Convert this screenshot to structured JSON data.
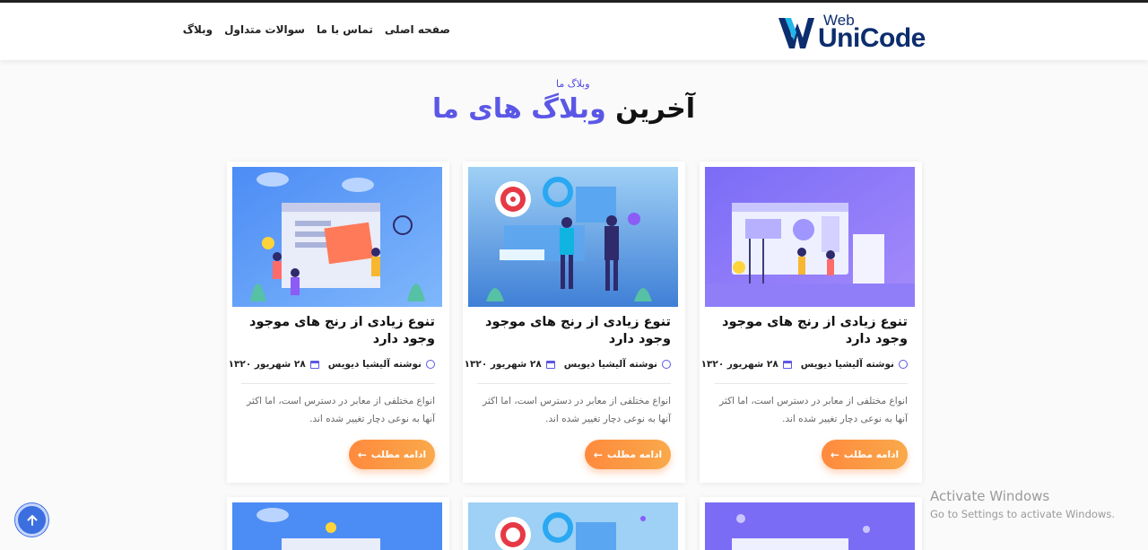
{
  "header": {
    "logo_web": "Web",
    "logo_unicode": "UniCode",
    "nav": [
      {
        "label": "صفحه اصلی"
      },
      {
        "label": "تماس با ما"
      },
      {
        "label": "سوالات متداول"
      },
      {
        "label": "وبلاگ"
      }
    ]
  },
  "section": {
    "eyebrow": "وبلاگ ما",
    "heading_plain": "آخرین",
    "heading_highlight": "وبلاگ های ما"
  },
  "cards": [
    {
      "image": "marketing-team-illustration",
      "title": "تنوع زیادی از رنج های موجود وجود دارد",
      "author": "نوشته آلیشیا دیویس",
      "date": "۲۸ شهریور ۱۳۲۰",
      "excerpt": "انواع مختلفی از معابر در دسترس است، اما اکثر آنها به نوعی دچار تغییر شده اند.",
      "button": "ادامه مطلب"
    },
    {
      "image": "business-target-illustration",
      "title": "تنوع زیادی از رنج های موجود وجود دارد",
      "author": "نوشته آلیشیا دیویس",
      "date": "۲۸ شهریور ۱۳۲۰",
      "excerpt": "انواع مختلفی از معابر در دسترس است، اما اکثر آنها به نوعی دچار تغییر شده اند.",
      "button": "ادامه مطلب"
    },
    {
      "image": "web-team-illustration",
      "title": "تنوع زیادی از رنج های موجود وجود دارد",
      "author": "نوشته آلیشیا دیویس",
      "date": "۲۸ شهریور ۱۳۲۰",
      "excerpt": "انواع مختلفی از معابر در دسترس است، اما اکثر آنها به نوعی دچار تغییر شده اند.",
      "button": "ادامه مطلب"
    }
  ],
  "watermark": {
    "line1": "Activate Windows",
    "line2": "Go to Settings to activate Windows."
  },
  "colors": {
    "accent": "#5b57e6",
    "button_start": "#ff8a3d",
    "button_end": "#f9a94b",
    "scroll_button": "#3b6fe0"
  },
  "icons": {
    "author": "user-icon",
    "date": "calendar-icon",
    "button": "arrow-left-icon",
    "scroll": "arrow-up-icon"
  }
}
